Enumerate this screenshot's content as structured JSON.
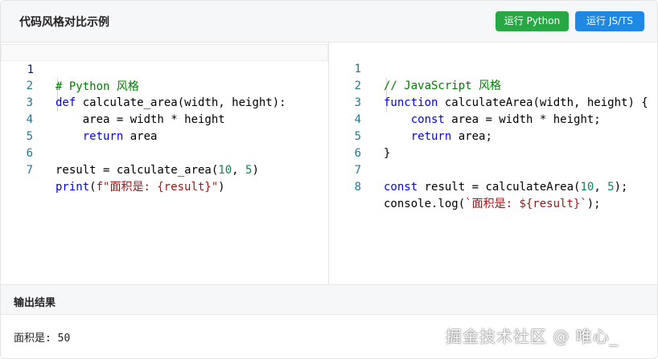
{
  "header": {
    "title": "代码风格对比示例",
    "run_python_label": "运行 Python",
    "run_js_label": "运行 JS/TS"
  },
  "python_editor": {
    "line_numbers": [
      "1",
      "2",
      "3",
      "4",
      "5",
      "6",
      "7"
    ],
    "lines": [
      "# Python 风格",
      "def calculate_area(width, height):",
      "    area = width * height",
      "    return area",
      "",
      "result = calculate_area(10, 5)",
      "print(f\"面积是: {result}\")"
    ]
  },
  "js_editor": {
    "line_numbers": [
      "1",
      "2",
      "3",
      "4",
      "5",
      "6",
      "7",
      "8"
    ],
    "lines": [
      "// JavaScript 风格",
      "function calculateArea(width, height) {",
      "    const area = width * height;",
      "    return area;",
      "}",
      "",
      "const result = calculateArea(10, 5);",
      "console.log(`面积是: ${result}`);"
    ]
  },
  "output": {
    "title": "输出结果",
    "text": "面积是: 50"
  },
  "watermark": "掘金技术社区 @ 唯心_",
  "colors": {
    "python_button": "#28a745",
    "js_button": "#1e88e5",
    "keyword": "#0000ff",
    "comment": "#008000",
    "number": "#098658",
    "string": "#a31515",
    "line_number": "#237893"
  }
}
